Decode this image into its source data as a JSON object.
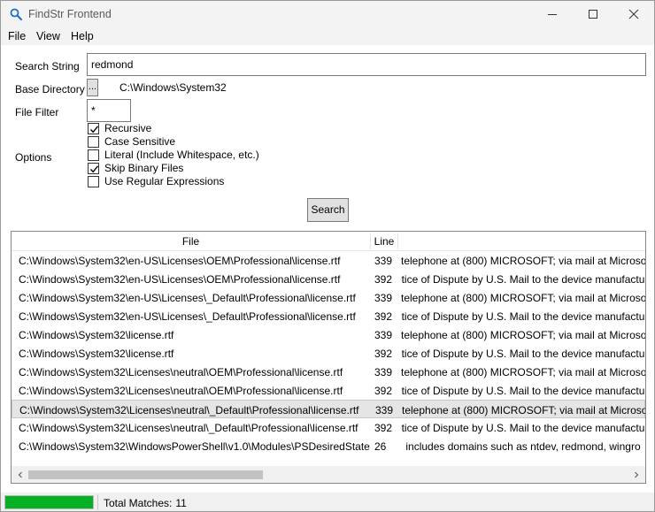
{
  "window": {
    "title": "FindStr Frontend",
    "icon": "search-icon",
    "controls": [
      "minimize-icon",
      "maximize-icon",
      "close-icon"
    ]
  },
  "menu": [
    {
      "label": "File"
    },
    {
      "label": "View"
    },
    {
      "label": "Help"
    }
  ],
  "form": {
    "search_label": "Search String",
    "search_value": "redmond",
    "base_dir_label": "Base Directory",
    "browse_label": "...",
    "base_dir_value": "C:\\Windows\\System32",
    "filter_label": "File Filter",
    "filter_value": "*",
    "options_label": "Options",
    "options": [
      {
        "label": "Recursive",
        "checked": true
      },
      {
        "label": "Case Sensitive",
        "checked": false
      },
      {
        "label": "Literal (Include Whitespace, etc.)",
        "checked": false
      },
      {
        "label": "Skip Binary Files",
        "checked": true
      },
      {
        "label": "Use Regular Expressions",
        "checked": false
      }
    ],
    "search_button": "Search"
  },
  "results": {
    "columns": [
      "File",
      "Line",
      ""
    ],
    "rows": [
      {
        "file": "C:\\Windows\\System32\\en-US\\Licenses\\OEM\\Professional\\license.rtf",
        "line": "339",
        "text": "telephone at (800) MICROSOFT; via mail at Microso"
      },
      {
        "file": "C:\\Windows\\System32\\en-US\\Licenses\\OEM\\Professional\\license.rtf",
        "line": "392",
        "text": "tice of Dispute by U.S. Mail to the device manufactu"
      },
      {
        "file": "C:\\Windows\\System32\\en-US\\Licenses\\_Default\\Professional\\license.rtf",
        "line": "339",
        "text": "telephone at (800) MICROSOFT; via mail at Microso"
      },
      {
        "file": "C:\\Windows\\System32\\en-US\\Licenses\\_Default\\Professional\\license.rtf",
        "line": "392",
        "text": "tice of Dispute by U.S. Mail to the device manufactu"
      },
      {
        "file": "C:\\Windows\\System32\\license.rtf",
        "line": "339",
        "text": "telephone at (800) MICROSOFT; via mail at Microso"
      },
      {
        "file": "C:\\Windows\\System32\\license.rtf",
        "line": "392",
        "text": "tice of Dispute by U.S. Mail to the device manufactu"
      },
      {
        "file": "C:\\Windows\\System32\\Licenses\\neutral\\OEM\\Professional\\license.rtf",
        "line": "339",
        "text": "telephone at (800) MICROSOFT; via mail at Microso"
      },
      {
        "file": "C:\\Windows\\System32\\Licenses\\neutral\\OEM\\Professional\\license.rtf",
        "line": "392",
        "text": "tice of Dispute by U.S. Mail to the device manufactu"
      },
      {
        "file": "C:\\Windows\\System32\\Licenses\\neutral\\_Default\\Professional\\license.rtf",
        "line": "339",
        "text": "telephone at (800) MICROSOFT; via mail at Microso",
        "selected": true
      },
      {
        "file": "C:\\Windows\\System32\\Licenses\\neutral\\_Default\\Professional\\license.rtf",
        "line": "392",
        "text": "tice of Dispute by U.S. Mail to the device manufactu"
      },
      {
        "file": "C:\\Windows\\System32\\WindowsPowerShell\\v1.0\\Modules\\PSDesiredState",
        "line": "26",
        "text": "includes domains such as ntdev, redmond, wingro"
      }
    ]
  },
  "status": {
    "progress_percent": 100,
    "progress_color": "#06b025",
    "label": "Total Matches:",
    "value": "11"
  },
  "colors": {
    "selected_row": "#e5e5e5",
    "titlebar": "#f3f3f3",
    "icon_blue": "#1a6fd0"
  }
}
